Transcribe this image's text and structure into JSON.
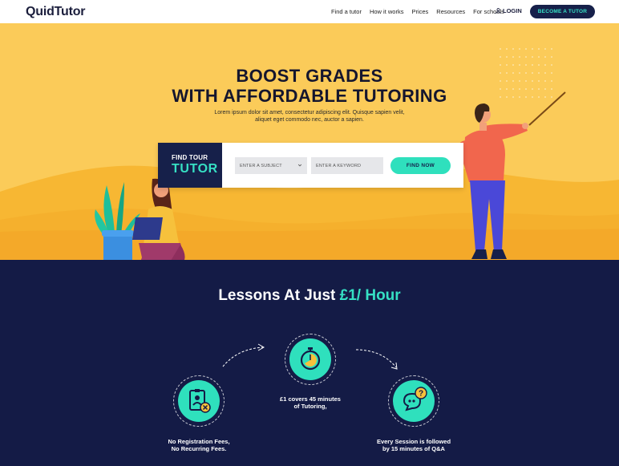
{
  "nav": {
    "logo": "QuidTutor",
    "links": [
      "Find a tutor",
      "How it works",
      "Prices",
      "Resources",
      "For schools"
    ],
    "login": "LOGIN",
    "cta": "BECOME A TUTOR"
  },
  "hero": {
    "title_line1": "BOOST GRADES",
    "title_line2": "WITH AFFORDABLE TUTORING",
    "subtitle_line1": "Lorem ipsum dolor sit amet, consectetur adipiscing elit. Quisque sapien velit,",
    "subtitle_line2": "aliquet eget commodo nec, auctor a sapien.",
    "search": {
      "label_line1": "FIND TOUR",
      "label_line2": "TUTOR",
      "subject_placeholder": "ENTER A SUBJECT",
      "keyword_placeholder": "ENTER A KEYWORD",
      "button": "FIND NOW"
    }
  },
  "lessons": {
    "title_prefix": "Lessons At Just",
    "title_accent": "£1/ Hour",
    "features": [
      {
        "icon": "id-card-x-icon",
        "line1": "No Registration Fees,",
        "line2": "No Recurring Fees."
      },
      {
        "icon": "stopwatch-icon",
        "line1": "£1 covers 45 minutes",
        "line2": "of Tutoring,"
      },
      {
        "icon": "question-chat-icon",
        "line1": "Every Session is followed",
        "line2": "by 15 minutes of Q&A"
      }
    ]
  },
  "colors": {
    "navy": "#141b46",
    "yellow": "#fbcb59",
    "teal": "#2fe0bd"
  }
}
